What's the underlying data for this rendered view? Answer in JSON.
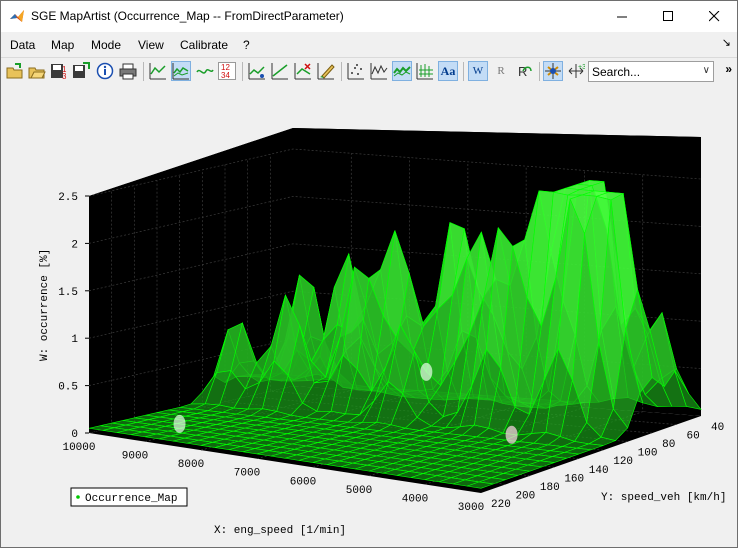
{
  "window": {
    "title": "SGE MapArtist (Occurrence_Map -- FromDirectParameter)"
  },
  "menu": {
    "items": [
      "Data",
      "Map",
      "Mode",
      "View",
      "Calibrate",
      "?"
    ]
  },
  "toolbar": {
    "search_placeholder": "Search...",
    "buttons": [
      "open-icon",
      "open-folder-icon",
      "save-as-icon",
      "save-icon",
      "info-icon",
      "print-icon",
      "line-view-icon",
      "surface-view-icon",
      "wave-view-icon",
      "numeric-view-icon",
      "smooth-icon",
      "smooth-line-icon",
      "cut-icon",
      "edit-icon",
      "scatter-icon",
      "mesh-icon",
      "green-surface-icon",
      "grid-icon",
      "text-icon",
      "w-icon",
      "r-icon",
      "rotate-icon",
      "zoom-icon",
      "data-cursor-icon"
    ],
    "labels": {
      "text": "Aa",
      "w": "W",
      "r": "R"
    }
  },
  "chart_data": {
    "type": "surface",
    "title": "",
    "xlabel": "X: eng_speed [1/min]",
    "ylabel": "Y: speed_veh [km/h]",
    "zlabel": "W: occurrence [%]",
    "x_ticks": [
      "10000",
      "9000",
      "8000",
      "7000",
      "6000",
      "5000",
      "4000",
      "3000"
    ],
    "y_ticks": [
      "220",
      "200",
      "180",
      "160",
      "140",
      "120",
      "100",
      "80",
      "60",
      "40"
    ],
    "z_ticks": [
      "0",
      "0.5",
      "1",
      "1.5",
      "2",
      "2.5"
    ],
    "xlim": [
      3000,
      10000
    ],
    "ylim": [
      40,
      220
    ],
    "zlim": [
      0,
      2.5
    ],
    "grid": true,
    "legend": {
      "position": "bottom-left",
      "entries": [
        "Occurrence_Map"
      ]
    },
    "series": [
      {
        "name": "Occurrence_Map",
        "color": "#00e000"
      }
    ],
    "peaks": [
      {
        "x": 4300,
        "y": 60,
        "z": 2.4
      },
      {
        "x": 4200,
        "y": 80,
        "z": 2.3
      },
      {
        "x": 4400,
        "y": 70,
        "z": 2.1
      },
      {
        "x": 4700,
        "y": 90,
        "z": 2.1
      },
      {
        "x": 4000,
        "y": 100,
        "z": 2.0
      },
      {
        "x": 5200,
        "y": 100,
        "z": 1.9
      },
      {
        "x": 3700,
        "y": 90,
        "z": 1.8
      },
      {
        "x": 6400,
        "y": 80,
        "z": 1.8
      },
      {
        "x": 3500,
        "y": 80,
        "z": 1.6
      },
      {
        "x": 5800,
        "y": 90,
        "z": 1.6
      },
      {
        "x": 7200,
        "y": 90,
        "z": 1.5
      },
      {
        "x": 8300,
        "y": 80,
        "z": 1.4
      },
      {
        "x": 7700,
        "y": 100,
        "z": 1.4
      },
      {
        "x": 8700,
        "y": 110,
        "z": 1.2
      },
      {
        "x": 9400,
        "y": 60,
        "z": 1.3
      },
      {
        "x": 9600,
        "y": 110,
        "z": 0.9
      },
      {
        "x": 6700,
        "y": 110,
        "z": 1.0
      },
      {
        "x": 3300,
        "y": 60,
        "z": 1.1
      }
    ]
  }
}
